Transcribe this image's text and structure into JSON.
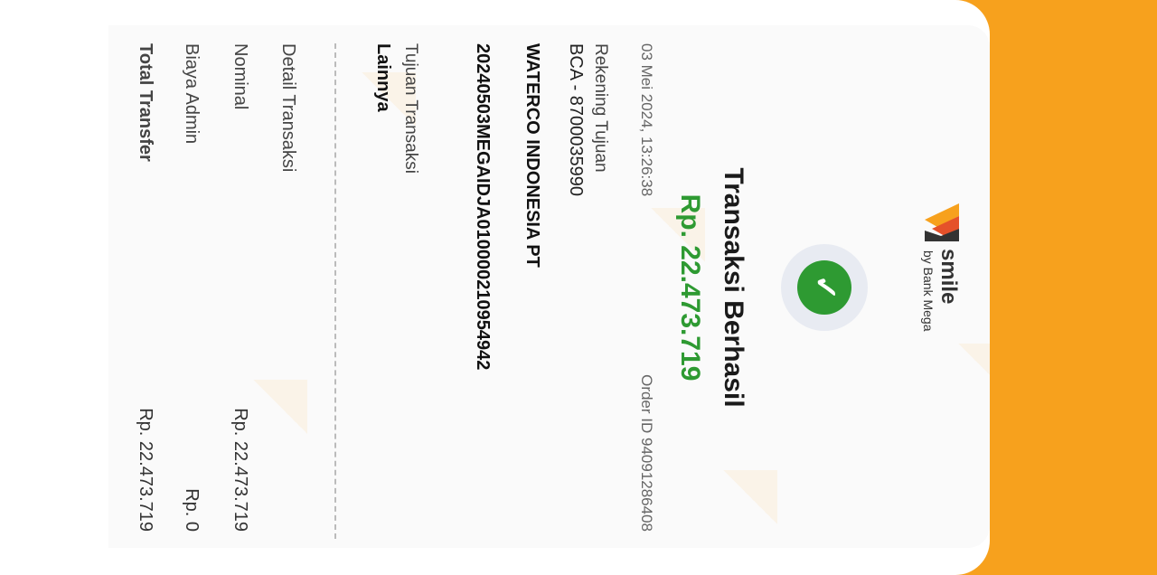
{
  "brand": {
    "name": "smile",
    "sub": "by Bank Mega",
    "colors": {
      "orange": "#f7a11d",
      "red": "#e5512a",
      "dark": "#333333"
    }
  },
  "status": {
    "icon": "check-icon",
    "title": "Transaksi Berhasil",
    "amount": "Rp. 22.473.719",
    "color": "#2e9a32"
  },
  "meta": {
    "datetime": "03 Mei 2024, 13:26:38",
    "order_id": "Order ID 94091286408"
  },
  "recipient": {
    "label": "Rekening Tujuan",
    "account": "BCA - 8700035990",
    "name": "WATERCO INDONESIA PT",
    "reference": "20240503MEGAIDJA010000210954942"
  },
  "purpose": {
    "label": "Tujuan Transaksi",
    "value": "Lainnya"
  },
  "details": {
    "header": "Detail Transaksi",
    "rows": [
      {
        "label": "Nominal",
        "value": "Rp. 22.473.719"
      },
      {
        "label": "Biaya Admin",
        "value": "Rp. 0"
      },
      {
        "label": "Total Transfer",
        "value": "Rp. 22.473.719"
      }
    ]
  }
}
